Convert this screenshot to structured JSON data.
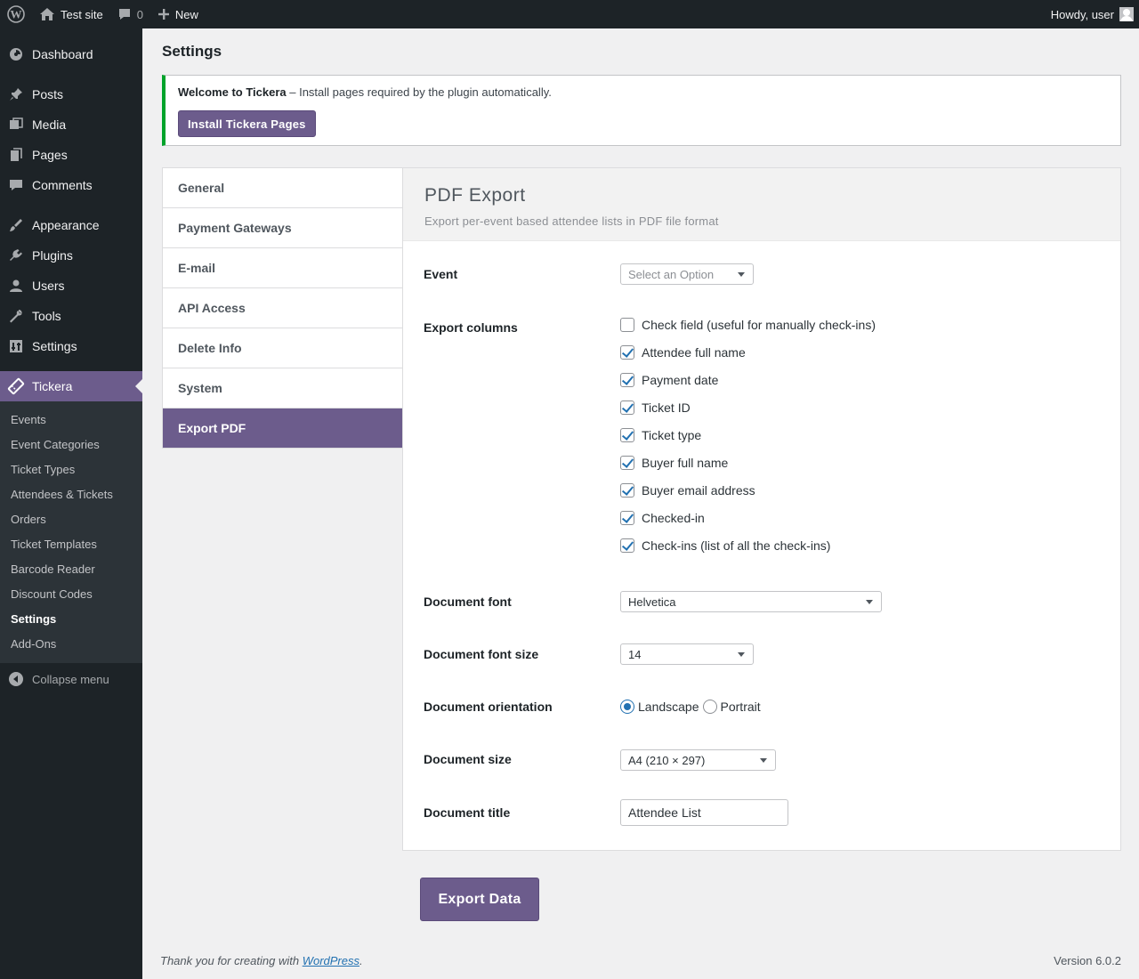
{
  "admin_bar": {
    "site_name": "Test site",
    "comments_count": "0",
    "new_label": "New",
    "greeting": "Howdy, user"
  },
  "menu": {
    "items": [
      {
        "label": "Dashboard",
        "icon": "dashboard-icon"
      },
      {
        "label": "Posts",
        "icon": "pin-icon"
      },
      {
        "label": "Media",
        "icon": "media-icon"
      },
      {
        "label": "Pages",
        "icon": "pages-icon"
      },
      {
        "label": "Comments",
        "icon": "comment-icon"
      },
      {
        "label": "Appearance",
        "icon": "brush-icon"
      },
      {
        "label": "Plugins",
        "icon": "plugin-icon"
      },
      {
        "label": "Users",
        "icon": "user-icon"
      },
      {
        "label": "Tools",
        "icon": "wrench-icon"
      },
      {
        "label": "Settings",
        "icon": "settings-icon"
      },
      {
        "label": "Tickera",
        "icon": "ticket-icon"
      }
    ],
    "submenu": [
      "Events",
      "Event Categories",
      "Ticket Types",
      "Attendees & Tickets",
      "Orders",
      "Ticket Templates",
      "Barcode Reader",
      "Discount Codes",
      "Settings",
      "Add-Ons"
    ],
    "collapse_label": "Collapse menu"
  },
  "page": {
    "title": "Settings",
    "notice_strong": "Welcome to Tickera",
    "notice_text": " – Install pages required by the plugin automatically.",
    "install_button": "Install Tickera Pages"
  },
  "tabs": [
    "General",
    "Payment Gateways",
    "E-mail",
    "API Access",
    "Delete Info",
    "System",
    "Export PDF"
  ],
  "panel": {
    "title": "PDF Export",
    "description": "Export per-event based attendee lists in PDF file format",
    "event_label": "Event",
    "event_placeholder": "Select an Option",
    "columns_label": "Export columns",
    "columns": [
      {
        "label": "Check field (useful for manually check-ins)",
        "checked": false
      },
      {
        "label": "Attendee full name",
        "checked": true
      },
      {
        "label": "Payment date",
        "checked": true
      },
      {
        "label": "Ticket ID",
        "checked": true
      },
      {
        "label": "Ticket type",
        "checked": true
      },
      {
        "label": "Buyer full name",
        "checked": true
      },
      {
        "label": "Buyer email address",
        "checked": true
      },
      {
        "label": "Checked-in",
        "checked": true
      },
      {
        "label": "Check-ins (list of all the check-ins)",
        "checked": true
      }
    ],
    "font_label": "Document font",
    "font_value": "Helvetica",
    "font_size_label": "Document font size",
    "font_size_value": "14",
    "orientation_label": "Document orientation",
    "orientation_landscape": "Landscape",
    "orientation_portrait": "Portrait",
    "orientation_selected": "Landscape",
    "size_label": "Document size",
    "size_value": "A4 (210 × 297)",
    "title_label": "Document title",
    "title_value": "Attendee List"
  },
  "export_button": "Export Data",
  "footer": {
    "thanks_prefix": "Thank you for creating with ",
    "wordpress_link": "WordPress",
    "thanks_suffix": ".",
    "version": "Version 6.0.2"
  },
  "colors": {
    "accent": "#6c5c8c",
    "admin_dark": "#1d2327",
    "notice_success": "#00a32a",
    "link": "#2271b1"
  }
}
